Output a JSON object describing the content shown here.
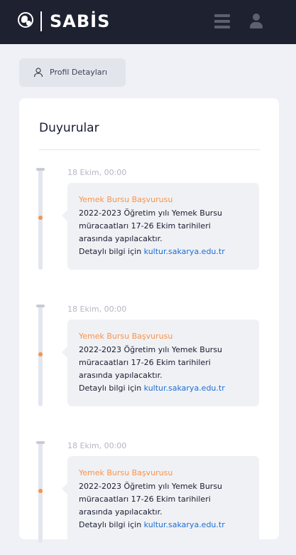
{
  "header": {
    "brand": "SABİS"
  },
  "profile_button": {
    "label": "Profil Detayları"
  },
  "announcements": {
    "title": "Duyurular",
    "items": [
      {
        "date": "18 Ekim, 00:00",
        "title": "Yemek Bursu Başvurusu",
        "line1": "2022-2023 Öğretim yılı Yemek Bursu",
        "line2": "müracaatları 17-26 Ekim tarihileri",
        "line3": "arasında yapılacaktır.",
        "detail_prefix": "Detaylı bilgi için",
        "link": "kultur.sakarya.edu.tr"
      },
      {
        "date": "18 Ekim, 00:00",
        "title": "Yemek Bursu Başvurusu",
        "line1": "2022-2023 Öğretim yılı Yemek Bursu",
        "line2": "müracaatları 17-26 Ekim tarihileri",
        "line3": "arasında yapılacaktır.",
        "detail_prefix": "Detaylı bilgi için",
        "link": "kultur.sakarya.edu.tr"
      },
      {
        "date": "18 Ekim, 00:00",
        "title": "Yemek Bursu Başvurusu",
        "line1": "2022-2023 Öğretim yılı Yemek Bursu",
        "line2": "müracaatları 17-26 Ekim tarihileri",
        "line3": "arasında yapılacaktır.",
        "detail_prefix": "Detaylı bilgi için",
        "link": "kultur.sakarya.edu.tr"
      }
    ]
  },
  "colors": {
    "header_bg": "#1e2130",
    "accent_orange": "#f7934c",
    "link_blue": "#1a6ed8"
  }
}
